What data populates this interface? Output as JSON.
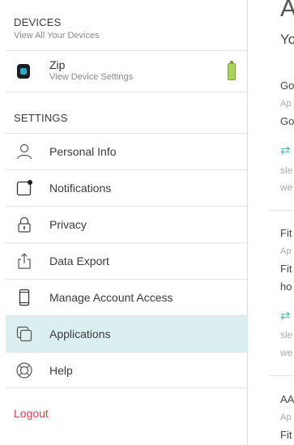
{
  "devices": {
    "title": "DEVICES",
    "subtitle": "View All Your Devices",
    "items": [
      {
        "name": "Zip",
        "subtitle": "View Device Settings",
        "battery": "full"
      }
    ]
  },
  "settings": {
    "title": "SETTINGS",
    "items": [
      {
        "label": "Personal Info",
        "icon": "person-icon"
      },
      {
        "label": "Notifications",
        "icon": "notification-icon"
      },
      {
        "label": "Privacy",
        "icon": "lock-icon"
      },
      {
        "label": "Data Export",
        "icon": "export-icon"
      },
      {
        "label": "Manage Account Access",
        "icon": "phone-icon"
      },
      {
        "label": "Applications",
        "icon": "applications-icon",
        "active": true
      },
      {
        "label": "Help",
        "icon": "lifebuoy-icon"
      }
    ]
  },
  "logout_label": "Logout",
  "content": {
    "heading": "A",
    "subheading": "Yo",
    "entries": [
      {
        "title": "Go",
        "meta": "Ap",
        "line": "Go",
        "arrow": "⇄",
        "detail1": "sle",
        "detail2": "we"
      },
      {
        "title": "Fit",
        "meta": "Ap",
        "line": "Fit",
        "line2": "ho",
        "arrow": "⇄",
        "detail1": "sle",
        "detail2": "we"
      },
      {
        "title": "AA",
        "meta": "Ap",
        "line": "Fit"
      }
    ]
  },
  "colors": {
    "active_bg": "#dbeff0",
    "logout": "#d0454b",
    "accent": "#56b7bb",
    "battery": "#a8d45a"
  }
}
